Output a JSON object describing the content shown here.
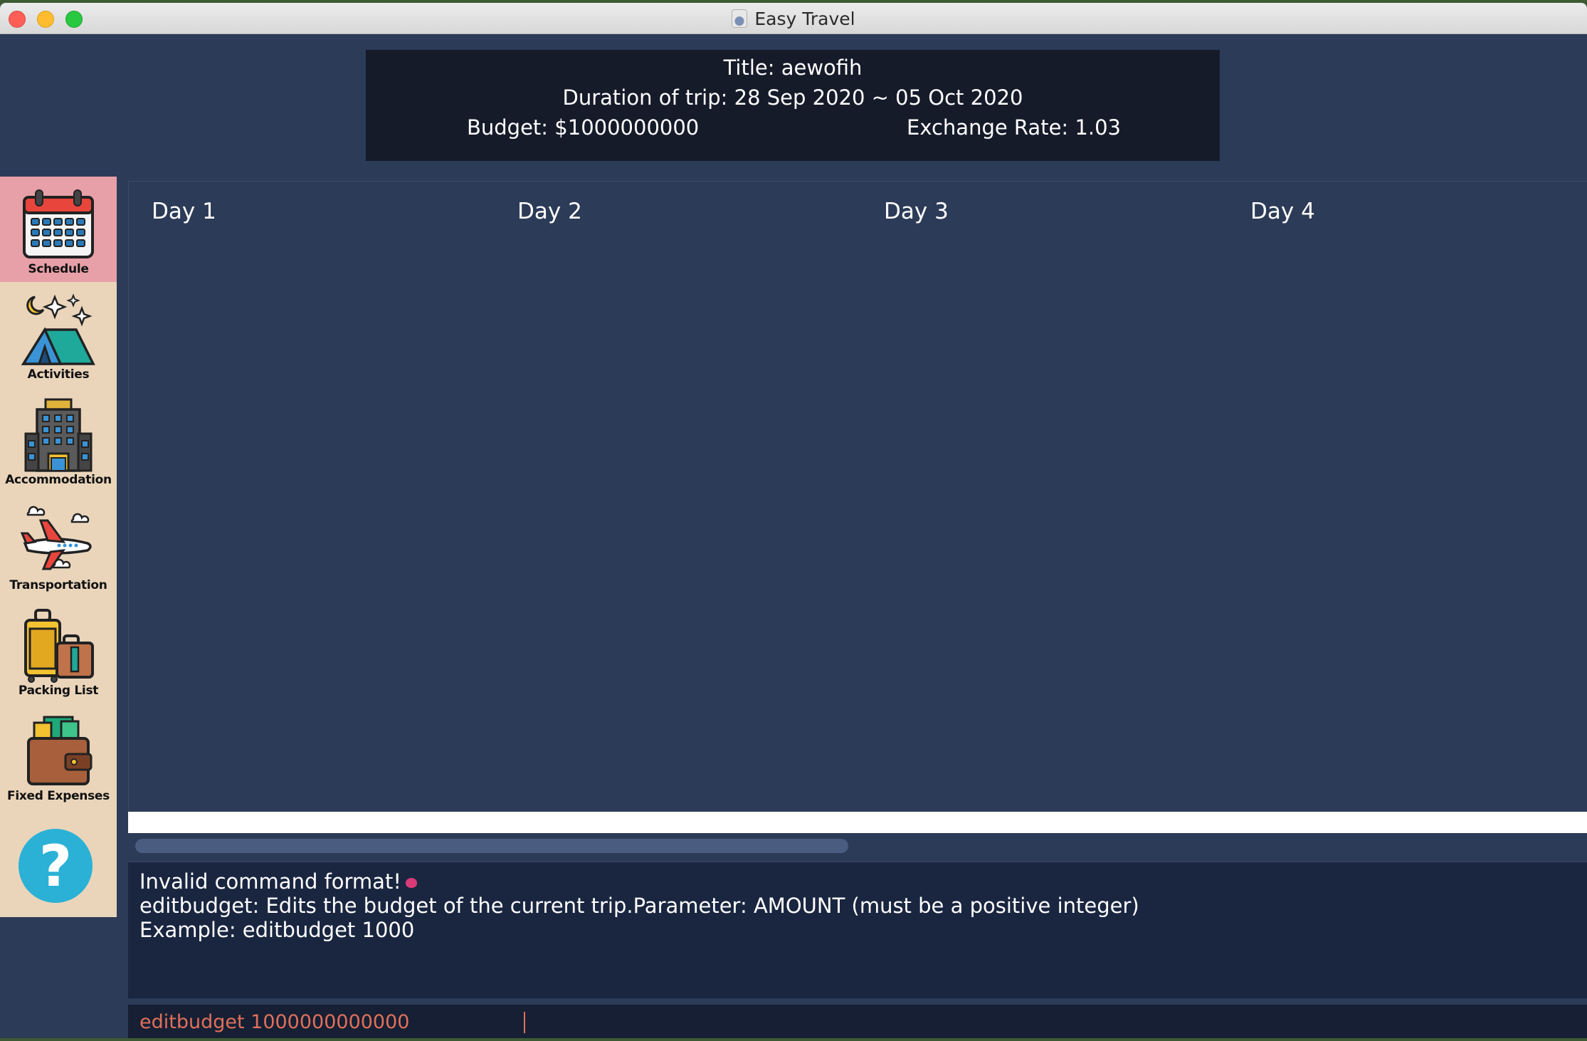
{
  "window": {
    "title": "Easy Travel"
  },
  "header": {
    "title": "Title: aewofih",
    "duration": "Duration of trip: 28 Sep 2020 ~ 05 Oct 2020",
    "budget": "Budget: $1000000000",
    "exchange_rate": "Exchange Rate: 1.03"
  },
  "sidebar": {
    "items": [
      {
        "label": "Schedule",
        "icon": "calendar-icon",
        "active": true
      },
      {
        "label": "Activities",
        "icon": "tent-icon"
      },
      {
        "label": "Accommodation",
        "icon": "hotel-icon"
      },
      {
        "label": "Transportation",
        "icon": "airplane-icon"
      },
      {
        "label": "Packing List",
        "icon": "luggage-icon"
      },
      {
        "label": "Fixed Expenses",
        "icon": "wallet-icon"
      }
    ],
    "help": {
      "label": "?",
      "icon": "help-icon"
    }
  },
  "schedule": {
    "days": [
      "Day 1",
      "Day 2",
      "Day 3",
      "Day 4"
    ]
  },
  "result": {
    "lines": [
      "Invalid command format!",
      "editbudget: Edits the budget of the current trip.Parameter: AMOUNT (must be a positive integer)",
      "Example: editbudget 1000"
    ]
  },
  "command": {
    "value": "editbudget 1000000000000"
  },
  "colors": {
    "background": "#2c3b57",
    "info_box": "#161b2a",
    "sidebar": "#ead5bb",
    "active_nav": "#e8a0a8",
    "command_text": "#e0705a"
  }
}
